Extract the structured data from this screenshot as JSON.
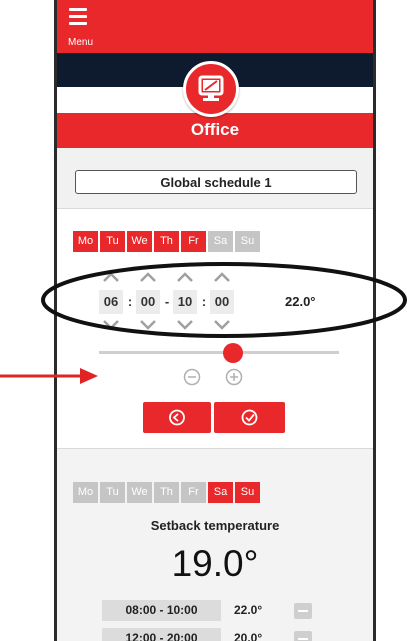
{
  "header": {
    "menu_label": "Menu",
    "title": "Office"
  },
  "schedule": {
    "name": "Global schedule 1"
  },
  "week1": {
    "days": [
      {
        "label": "Mo",
        "active": true
      },
      {
        "label": "Tu",
        "active": true
      },
      {
        "label": "We",
        "active": true
      },
      {
        "label": "Th",
        "active": true
      },
      {
        "label": "Fr",
        "active": true
      },
      {
        "label": "Sa",
        "active": false
      },
      {
        "label": "Su",
        "active": false
      }
    ]
  },
  "time_editor": {
    "start_hour": "06",
    "start_min": "00",
    "dash": "-",
    "end_hour": "10",
    "end_min": "00",
    "colon": ":",
    "temperature": "22.0°"
  },
  "slider": {
    "level_percent": 56
  },
  "week2": {
    "days": [
      {
        "label": "Mo",
        "active": false
      },
      {
        "label": "Tu",
        "active": false
      },
      {
        "label": "We",
        "active": false
      },
      {
        "label": "Th",
        "active": false
      },
      {
        "label": "Fr",
        "active": false
      },
      {
        "label": "Sa",
        "active": true
      },
      {
        "label": "Su",
        "active": true
      }
    ]
  },
  "setback": {
    "label": "Setback temperature",
    "temperature": "19.0°"
  },
  "ranges": [
    {
      "time": "08:00 - 10:00",
      "temp": "22.0°"
    },
    {
      "time": "12:00 - 20:00",
      "temp": "20.0°"
    }
  ],
  "colors": {
    "accent": "#e8282b",
    "dark_band": "#0e1a2e",
    "inactive_day": "#c5c5c5",
    "annotation": "#e02424"
  },
  "icons": [
    "menu-icon",
    "monitor-icon",
    "chevron-up-icon",
    "chevron-down-icon",
    "minus-circle-icon",
    "plus-circle-icon",
    "undo-icon",
    "check-icon",
    "minus-icon"
  ]
}
